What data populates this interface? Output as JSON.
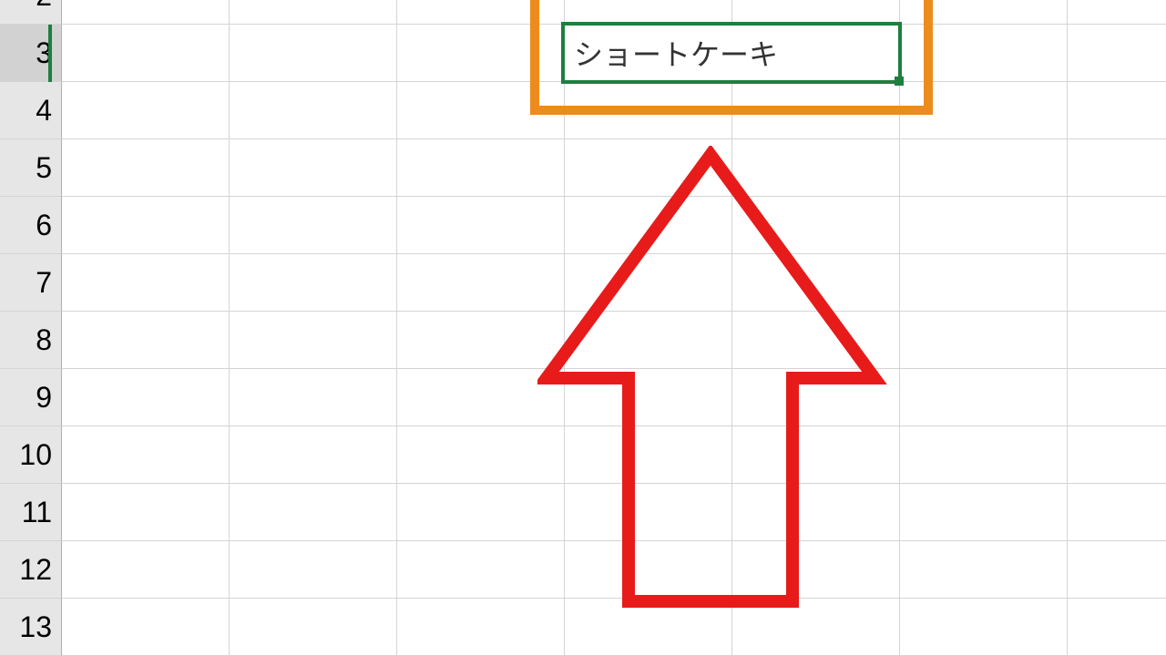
{
  "rows": {
    "labels": [
      "2",
      "3",
      "4",
      "5",
      "6",
      "7",
      "8",
      "9",
      "10",
      "11",
      "12",
      "13"
    ],
    "selected_index": 1
  },
  "active_cell": {
    "value": "ショートケーキ"
  },
  "colors": {
    "orange": "#ed8b1c",
    "green": "#1e7f3f",
    "red": "#e81b1b"
  }
}
